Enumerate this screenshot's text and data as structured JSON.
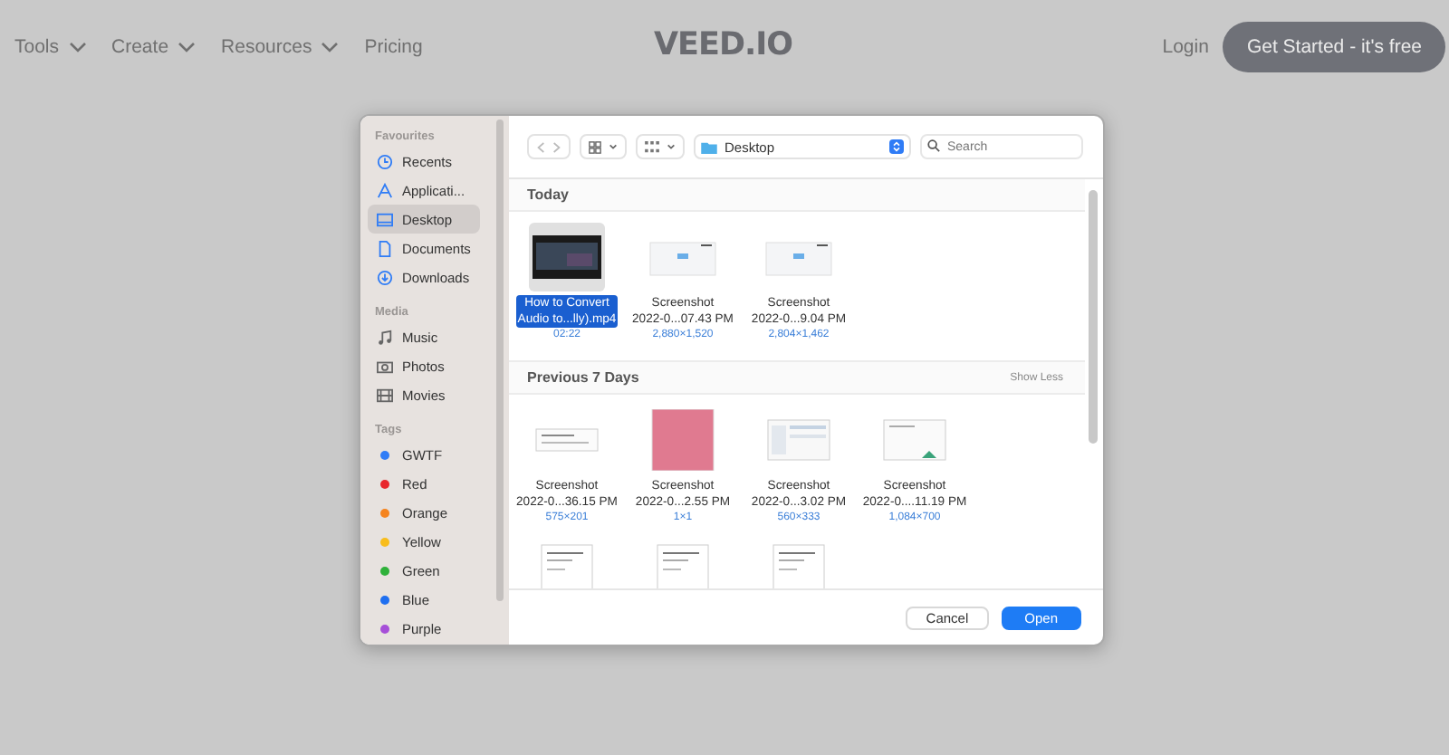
{
  "nav": {
    "links": [
      {
        "label": "Tools",
        "dropdown": true
      },
      {
        "label": "Create",
        "dropdown": true
      },
      {
        "label": "Resources",
        "dropdown": true
      },
      {
        "label": "Pricing",
        "dropdown": false
      }
    ],
    "logo": "VEED.IO",
    "login": "Login",
    "cta": "Get Started - it's free"
  },
  "dialog": {
    "sidebar": {
      "sections": [
        {
          "title": "Favourites",
          "items": [
            {
              "label": "Recents",
              "selected": false
            },
            {
              "label": "Applicati...",
              "selected": false
            },
            {
              "label": "Desktop",
              "selected": true
            },
            {
              "label": "Documents",
              "selected": false
            },
            {
              "label": "Downloads",
              "selected": false
            }
          ]
        },
        {
          "title": "Media",
          "items": [
            {
              "label": "Music",
              "selected": false
            },
            {
              "label": "Photos",
              "selected": false
            },
            {
              "label": "Movies",
              "selected": false
            }
          ]
        },
        {
          "title": "Tags",
          "tags": [
            {
              "label": "GWTF",
              "color": "#2f7cf6"
            },
            {
              "label": "Red",
              "color": "#e8262c"
            },
            {
              "label": "Orange",
              "color": "#f5841f"
            },
            {
              "label": "Yellow",
              "color": "#f8bd1c"
            },
            {
              "label": "Green",
              "color": "#2fb13a"
            },
            {
              "label": "Blue",
              "color": "#1f6ff0"
            },
            {
              "label": "Purple",
              "color": "#a64fd8"
            }
          ]
        }
      ]
    },
    "location": "Desktop",
    "search_placeholder": "Search",
    "sections": [
      {
        "title": "Today",
        "files": [
          {
            "kind": "video",
            "name": [
              "How to Convert",
              "Audio to...lly).mp4"
            ],
            "meta": "02:22",
            "selected": true
          },
          {
            "kind": "screenshot",
            "name": [
              "Screenshot",
              "2022-0...07.43 PM"
            ],
            "meta": "2,880×1,520",
            "selected": false
          },
          {
            "kind": "screenshot",
            "name": [
              "Screenshot",
              "2022-0...9.04 PM"
            ],
            "meta": "2,804×1,462",
            "selected": false
          }
        ]
      },
      {
        "title": "Previous 7 Days",
        "action": "Show Less",
        "files": [
          {
            "kind": "banner",
            "name": [
              "Screenshot",
              "2022-0...36.15 PM"
            ],
            "meta": "575×201",
            "selected": false
          },
          {
            "kind": "pink",
            "name": [
              "Screenshot",
              "2022-0...2.55 PM"
            ],
            "meta": "1×1",
            "selected": false
          },
          {
            "kind": "table",
            "name": [
              "Screenshot",
              "2022-0...3.02 PM"
            ],
            "meta": "560×333",
            "selected": false
          },
          {
            "kind": "chart",
            "name": [
              "Screenshot",
              "2022-0....11.19 PM"
            ],
            "meta": "1,084×700",
            "selected": false
          },
          {
            "kind": "doc"
          },
          {
            "kind": "doc"
          },
          {
            "kind": "doc"
          }
        ]
      }
    ],
    "buttons": [
      {
        "label": "Cancel",
        "kind": "secondary"
      },
      {
        "label": "Open",
        "kind": "primary"
      }
    ]
  }
}
